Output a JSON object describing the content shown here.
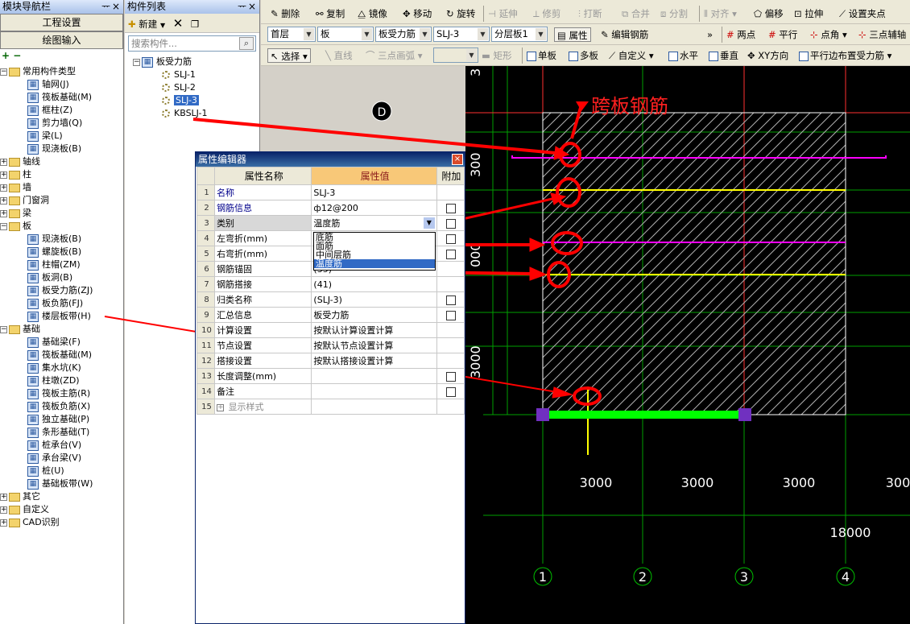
{
  "nav": {
    "title": "模块导航栏",
    "pin": "ᅲ",
    "close": "×",
    "btn1": "工程设置",
    "btn2": "绘图输入",
    "tree": [
      "常用构件类型",
      "轴网(J)",
      "筏板基础(M)",
      "框柱(Z)",
      "剪力墙(Q)",
      "梁(L)",
      "现浇板(B)",
      "轴线",
      "柱",
      "墙",
      "门窗洞",
      "梁",
      "板",
      "现浇板(B)",
      "螺旋板(B)",
      "柱帽(ZM)",
      "板洞(B)",
      "板受力筋(ZJ)",
      "板负筋(FJ)",
      "楼层板带(H)",
      "基础",
      "基础梁(F)",
      "筏板基础(M)",
      "集水坑(K)",
      "柱墩(ZD)",
      "筏板主筋(R)",
      "筏板负筋(X)",
      "独立基础(P)",
      "条形基础(T)",
      "桩承台(V)",
      "承台梁(V)",
      "桩(U)",
      "基础板带(W)",
      "其它",
      "自定义",
      "CAD识别"
    ]
  },
  "comp": {
    "title": "构件列表",
    "pin": "ᅲ",
    "close": "×",
    "new_label": "新建",
    "search_placeholder": "搜索构件...",
    "root": "板受力筋",
    "items": [
      "SLJ-1",
      "SLJ-2",
      "SLJ-3",
      "KBSLJ-1"
    ]
  },
  "toolbar": {
    "row1": [
      "删除",
      "复制",
      "镜像",
      "移动",
      "旋转",
      "延伸",
      "修剪",
      "打断",
      "合并",
      "分割",
      "对齐",
      "偏移",
      "拉伸",
      "设置夹点"
    ],
    "row2": {
      "floor": "首层",
      "type": "板",
      "sub": "板受力筋",
      "item": "SLJ-3",
      "layer": "分层板1",
      "attr": "属性",
      "edit": "编辑钢筋",
      "more": "»",
      "two": "两点",
      "parallel": "平行",
      "pointangle": "点角",
      "threepoint": "三点辅轴"
    },
    "row3": [
      "选择",
      "直线",
      "三点画弧",
      "矩形",
      "单板",
      "多板",
      "自定义",
      "水平",
      "垂直",
      "XY方向",
      "平行边布置受力筋"
    ]
  },
  "prop": {
    "title": "属性编辑器",
    "close": "×",
    "h_name": "属性名称",
    "h_val": "属性值",
    "h_add": "附加",
    "rows": [
      {
        "n": "1",
        "name": "名称",
        "val": "SLJ-3",
        "blue": true,
        "chk": false
      },
      {
        "n": "2",
        "name": "钢筋信息",
        "val": "ф12@200",
        "blue": true,
        "chk": true
      },
      {
        "n": "3",
        "name": "类别",
        "val": "温度筋",
        "blue": false,
        "chk": true
      },
      {
        "n": "4",
        "name": "左弯折(mm)",
        "val": "",
        "blue": false,
        "chk": true
      },
      {
        "n": "5",
        "name": "右弯折(mm)",
        "val": "",
        "blue": false,
        "chk": true
      },
      {
        "n": "6",
        "name": "钢筋锚固",
        "val": "(35)",
        "blue": false,
        "chk": false
      },
      {
        "n": "7",
        "name": "钢筋搭接",
        "val": "(41)",
        "blue": false,
        "chk": false
      },
      {
        "n": "8",
        "name": "归类名称",
        "val": "(SLJ-3)",
        "blue": false,
        "chk": true
      },
      {
        "n": "9",
        "name": "汇总信息",
        "val": "板受力筋",
        "blue": false,
        "chk": true
      },
      {
        "n": "10",
        "name": "计算设置",
        "val": "按默认计算设置计算",
        "blue": false,
        "chk": false
      },
      {
        "n": "11",
        "name": "节点设置",
        "val": "按默认节点设置计算",
        "blue": false,
        "chk": false
      },
      {
        "n": "12",
        "name": "搭接设置",
        "val": "按默认搭接设置计算",
        "blue": false,
        "chk": false
      },
      {
        "n": "13",
        "name": "长度调整(mm)",
        "val": "",
        "blue": false,
        "chk": true
      },
      {
        "n": "14",
        "name": "备注",
        "val": "",
        "blue": false,
        "chk": true
      },
      {
        "n": "15",
        "name": "显示样式",
        "val": "",
        "blue": false,
        "chk": false
      }
    ],
    "dropdown": [
      "底筋",
      "面筋",
      "中间层筋",
      "温度筋"
    ]
  },
  "cad": {
    "annotation": "跨板钢筋",
    "axis_d": "D",
    "dims": [
      "3000",
      "3000",
      "3000",
      "300"
    ],
    "total": "18000",
    "axes": [
      "1",
      "2",
      "3",
      "4"
    ],
    "vdims": [
      "300",
      "000",
      "3000"
    ],
    "top3": "3"
  },
  "colors": {
    "accent": "#316ac5",
    "red": "#ff0000",
    "magenta": "#ff00ff",
    "yellow": "#ffff00",
    "green": "#00ff00"
  }
}
